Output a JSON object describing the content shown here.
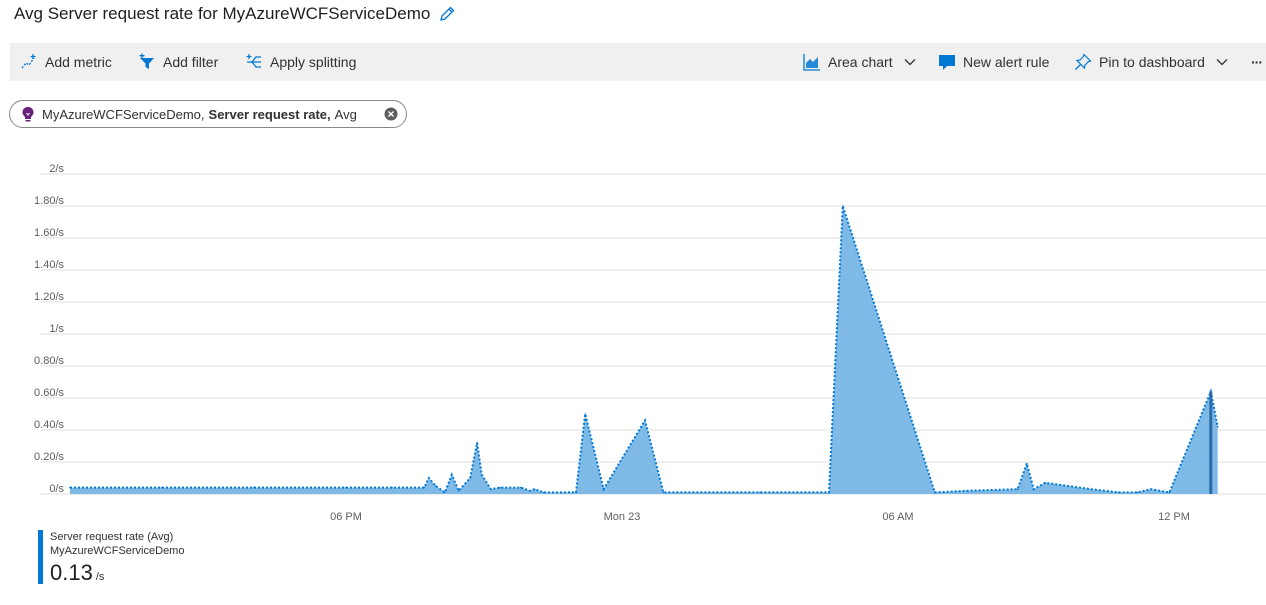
{
  "title": "Avg Server request rate for MyAzureWCFServiceDemo",
  "toolbar": {
    "add_metric": "Add metric",
    "add_filter": "Add filter",
    "apply_splitting": "Apply splitting",
    "area_chart": "Area chart",
    "new_alert_rule": "New alert rule",
    "pin_to_dashboard": "Pin to dashboard",
    "more": "···"
  },
  "metric_pill": {
    "resource": "MyAzureWCFServiceDemo,",
    "metric": "Server request rate,",
    "aggregation": "Avg"
  },
  "legend": {
    "series_name": "Server request rate (Avg)",
    "resource": "MyAzureWCFServiceDemo",
    "value": "0.13",
    "unit": "/s"
  },
  "colors": {
    "accent": "#0078d4",
    "area_fill": "#7fbae6",
    "grid": "#e1dfdd",
    "toolbar_bg": "#f0f0f0"
  },
  "chart_data": {
    "type": "area",
    "y_ticks": [
      0,
      0.2,
      0.4,
      0.6,
      0.8,
      1.0,
      1.2,
      1.4,
      1.6,
      1.8,
      2.0
    ],
    "y_tick_labels": [
      "0/s",
      "0.20/s",
      "0.40/s",
      "0.60/s",
      "0.80/s",
      "1/s",
      "1.20/s",
      "1.40/s",
      "1.60/s",
      "1.80/s",
      "2/s"
    ],
    "ylim": [
      0,
      2
    ],
    "x_range_hours": [
      12,
      38
    ],
    "x_ticks": [
      {
        "hour": 18,
        "label": "06 PM"
      },
      {
        "hour": 24,
        "label": "Mon 23"
      },
      {
        "hour": 30,
        "label": "06 AM"
      },
      {
        "hour": 36,
        "label": "12 PM"
      }
    ],
    "grid": true,
    "series": [
      {
        "name": "Server request rate (Avg)",
        "points": [
          [
            12.0,
            0.04
          ],
          [
            14.0,
            0.04
          ],
          [
            16.0,
            0.04
          ],
          [
            18.0,
            0.04
          ],
          [
            19.0,
            0.04
          ],
          [
            19.7,
            0.04
          ],
          [
            19.8,
            0.1
          ],
          [
            19.95,
            0.05
          ],
          [
            20.15,
            0.01
          ],
          [
            20.3,
            0.12
          ],
          [
            20.45,
            0.02
          ],
          [
            20.7,
            0.1
          ],
          [
            20.85,
            0.32
          ],
          [
            20.95,
            0.12
          ],
          [
            21.15,
            0.03
          ],
          [
            21.35,
            0.04
          ],
          [
            21.8,
            0.04
          ],
          [
            22.0,
            0.02
          ],
          [
            22.1,
            0.03
          ],
          [
            22.3,
            0.01
          ],
          [
            23.0,
            0.01
          ],
          [
            23.2,
            0.5
          ],
          [
            23.6,
            0.03
          ],
          [
            24.5,
            0.46
          ],
          [
            24.9,
            0.01
          ],
          [
            27.0,
            0.01
          ],
          [
            28.5,
            0.01
          ],
          [
            28.8,
            1.8
          ],
          [
            30.8,
            0.01
          ],
          [
            31.5,
            0.02
          ],
          [
            32.6,
            0.03
          ],
          [
            32.8,
            0.19
          ],
          [
            32.95,
            0.03
          ],
          [
            33.2,
            0.07
          ],
          [
            34.2,
            0.03
          ],
          [
            34.8,
            0.01
          ],
          [
            35.2,
            0.01
          ],
          [
            35.5,
            0.03
          ],
          [
            35.9,
            0.01
          ],
          [
            36.8,
            0.64
          ],
          [
            36.95,
            0.42
          ]
        ]
      }
    ]
  }
}
